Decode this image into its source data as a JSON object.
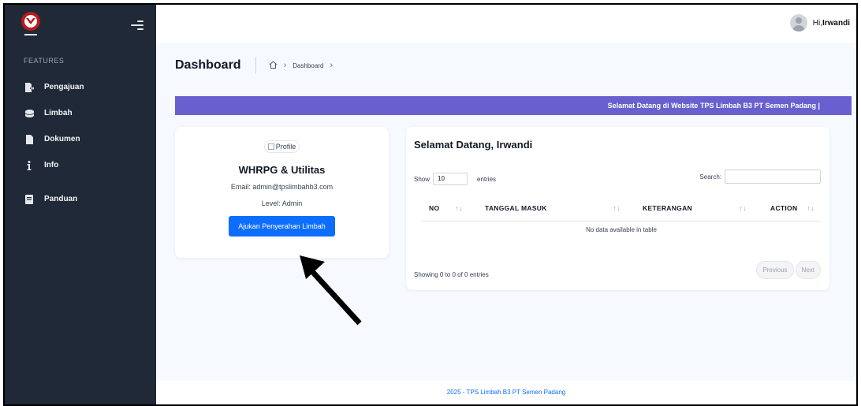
{
  "sidebar": {
    "section_label": "FEATURES",
    "items": [
      {
        "label": "Pengajuan",
        "icon": "file-arrow-icon"
      },
      {
        "label": "Limbah",
        "icon": "database-icon"
      },
      {
        "label": "Dokumen",
        "icon": "document-icon"
      },
      {
        "label": "Info",
        "icon": "info-icon"
      },
      {
        "label": "Panduan",
        "icon": "book-icon"
      }
    ]
  },
  "topbar": {
    "greeting": "Hi, ",
    "username": "Irwandi"
  },
  "header": {
    "title": "Dashboard",
    "breadcrumb": [
      "Dashboard"
    ]
  },
  "banner": {
    "text": "Selamat Datang di Website TPS Limbah B3 PT Semen Padang |"
  },
  "profile": {
    "image_alt": "Profile",
    "name": "WHRPG & Utilitas",
    "email": "Email: admin@tpslimbahb3.com",
    "level": "Level: Admin",
    "button_label": "Ajukan Penyerahan Limbah"
  },
  "table_card": {
    "title": "Selamat Datang, Irwandi",
    "show_label": "Show",
    "entries_value": "10",
    "entries_label": "entries",
    "search_label": "Search:",
    "columns": [
      "NO",
      "TANGGAL MASUK",
      "KETERANGAN",
      "ACTION"
    ],
    "empty_text": "No data available in table",
    "info_text": "Showing 0 to 0 of 0 entries",
    "prev_label": "Previous",
    "next_label": "Next"
  },
  "footer": {
    "text": "2025 - TPS Limbah B3 PT Semen Padang"
  },
  "colors": {
    "sidebar_bg": "#1f2937",
    "banner_bg": "#6a5fcf",
    "primary": "#0d6efd",
    "page_bg": "#f6f9ff"
  }
}
